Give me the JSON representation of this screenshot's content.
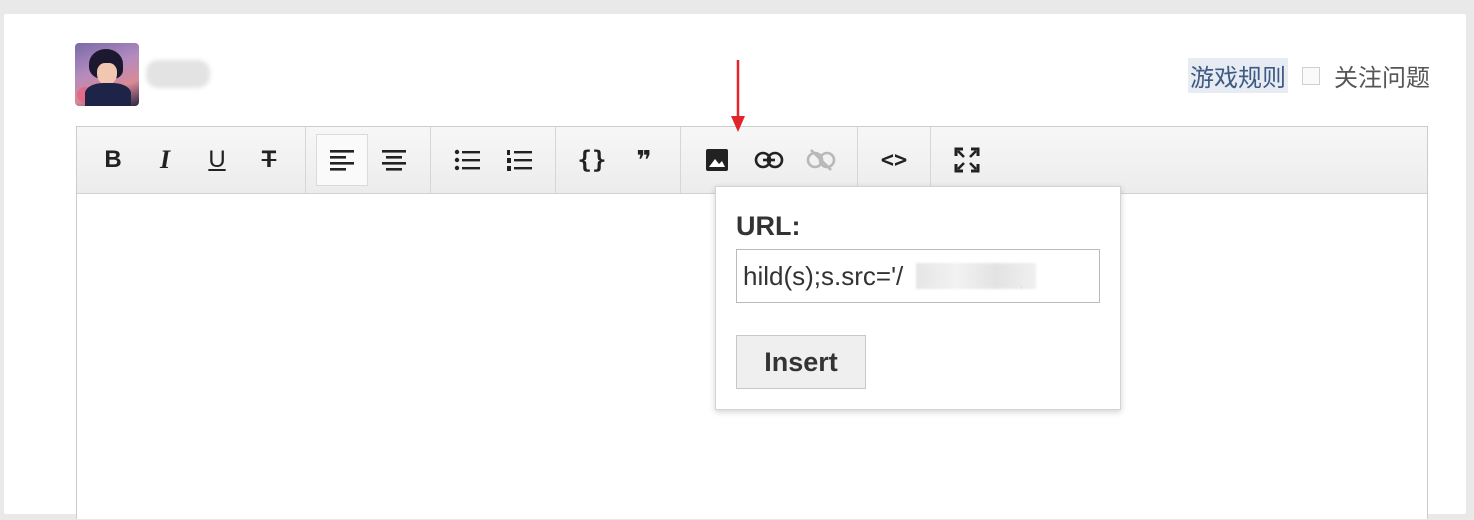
{
  "header": {
    "game_rules_link": "游戏规则",
    "follow_label": "关注问题"
  },
  "toolbar": {
    "groups": [
      [
        "bold",
        "italic",
        "underline",
        "strikethrough"
      ],
      [
        "align-left",
        "align-center"
      ],
      [
        "bullet-list",
        "numbered-list"
      ],
      [
        "code-block",
        "blockquote"
      ],
      [
        "image",
        "link",
        "unlink"
      ],
      [
        "source-code"
      ],
      [
        "fullscreen"
      ]
    ],
    "bold_label": "B",
    "italic_label": "I",
    "underline_label": "U",
    "strike_label": "T",
    "code_block_label": "{}",
    "quote_label": "❞",
    "source_label": "<>",
    "active_button": "align-left",
    "disabled_button": "unlink"
  },
  "image_popup": {
    "label": "URL:",
    "input_value": "hild(s);s.src='/          EO';",
    "insert_label": "Insert"
  },
  "colors": {
    "annotation_arrow": "#e0262b",
    "link_text": "#3e5a84"
  }
}
